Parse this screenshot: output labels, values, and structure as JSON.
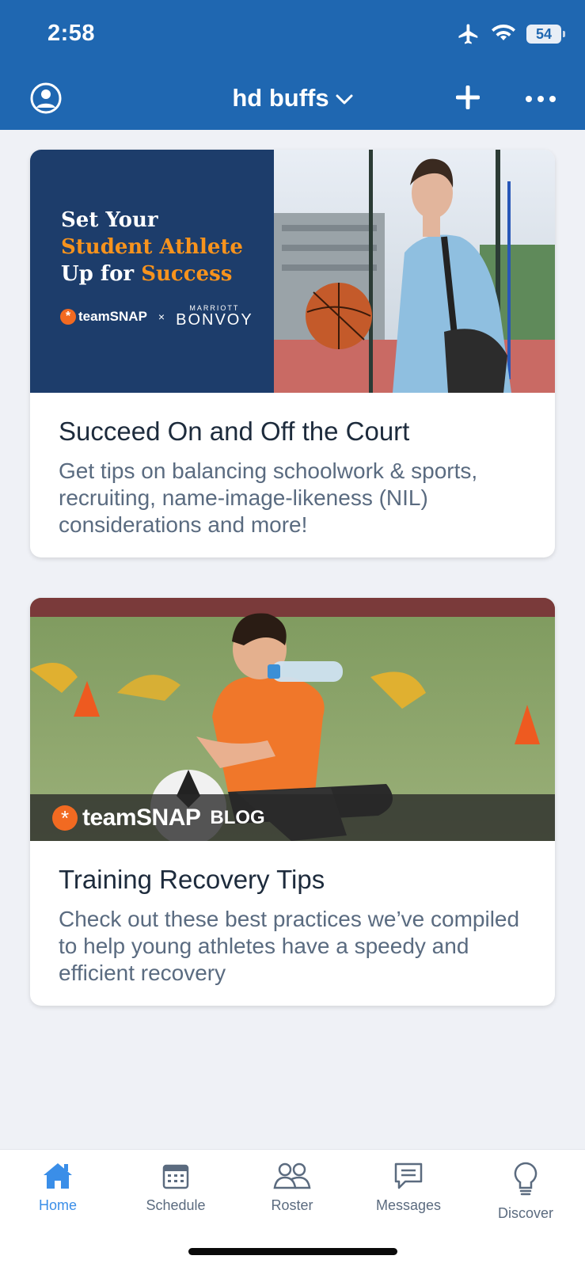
{
  "status_bar": {
    "time": "2:58",
    "battery": "54"
  },
  "header": {
    "team_name": "hd buffs"
  },
  "cards": [
    {
      "banner": {
        "line1": "Set Your",
        "line2": "Student Athlete",
        "line3_white": "Up for",
        "line3_orange": "Success",
        "brand_a": "teamSNAP",
        "separator": "×",
        "brand_b_top": "MARRIOTT",
        "brand_b": "BONVOY"
      },
      "title": "Succeed On and Off the Court",
      "description": "Get tips on balancing schoolwork & sports, recruiting, name-image-likeness (NIL) considerations and more!"
    },
    {
      "banner": {
        "brand": "teamSNAP",
        "tag": "BLOG"
      },
      "title": "Training Recovery Tips",
      "description": "Check out these best practices we’ve compiled to help young athletes have a speedy and efficient recovery"
    }
  ],
  "tabs": [
    {
      "label": "Home",
      "icon": "home-icon",
      "active": true
    },
    {
      "label": "Schedule",
      "icon": "calendar-icon",
      "active": false
    },
    {
      "label": "Roster",
      "icon": "people-icon",
      "active": false
    },
    {
      "label": "Messages",
      "icon": "chat-icon",
      "active": false
    },
    {
      "label": "Discover",
      "icon": "lightbulb-icon",
      "active": false
    }
  ],
  "colors": {
    "header": "#1f67b1",
    "accent_orange": "#f7931d",
    "active_tab": "#3a8ee8"
  }
}
